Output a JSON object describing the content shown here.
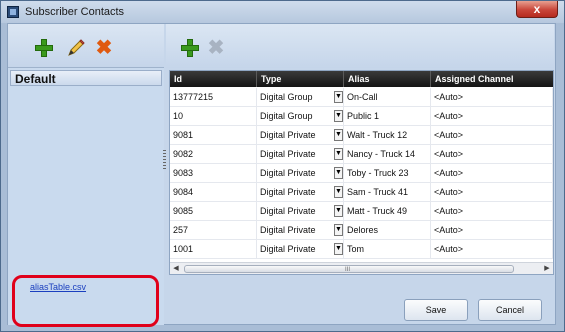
{
  "window": {
    "title": "Subscriber Contacts",
    "close_label": "x"
  },
  "left_panel": {
    "groups": [
      "Default"
    ],
    "csv_link": "aliasTable.csv"
  },
  "grid": {
    "columns": [
      "Id",
      "Type",
      "Alias",
      "Assigned Channel"
    ],
    "rows": [
      {
        "id": "13777215",
        "type": "Digital Group",
        "alias": "On-Call",
        "channel": "<Auto>"
      },
      {
        "id": "10",
        "type": "Digital Group",
        "alias": "Public 1",
        "channel": "<Auto>"
      },
      {
        "id": "9081",
        "type": "Digital Private",
        "alias": "Walt - Truck 12",
        "channel": "<Auto>"
      },
      {
        "id": "9082",
        "type": "Digital Private",
        "alias": "Nancy - Truck 14",
        "channel": "<Auto>"
      },
      {
        "id": "9083",
        "type": "Digital Private",
        "alias": "Toby - Truck 23",
        "channel": "<Auto>"
      },
      {
        "id": "9084",
        "type": "Digital Private",
        "alias": "Sam - Truck 41",
        "channel": "<Auto>"
      },
      {
        "id": "9085",
        "type": "Digital Private",
        "alias": "Matt - Truck 49",
        "channel": "<Auto>"
      },
      {
        "id": "257",
        "type": "Digital Private",
        "alias": "Delores",
        "channel": "<Auto>"
      },
      {
        "id": "1001",
        "type": "Digital Private",
        "alias": "Tom",
        "channel": "<Auto>"
      }
    ],
    "scroll_grip": "III"
  },
  "buttons": {
    "save": "Save",
    "cancel": "Cancel"
  }
}
